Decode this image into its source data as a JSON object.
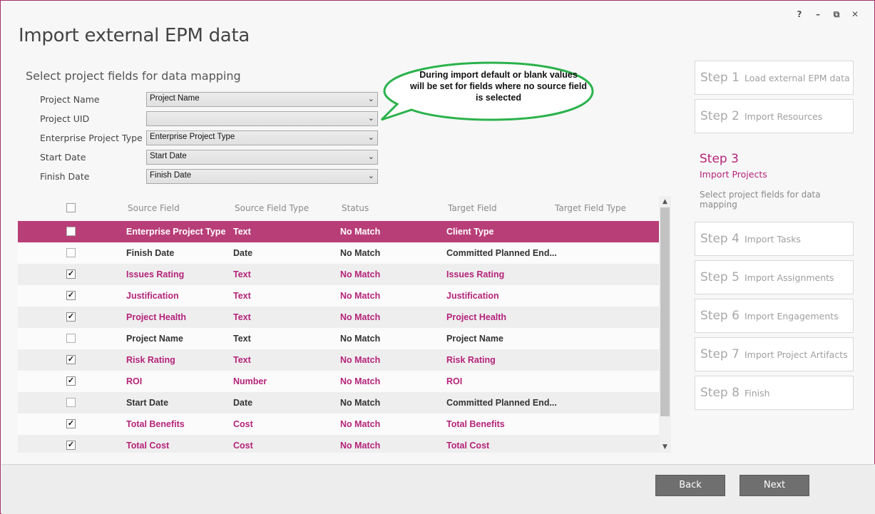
{
  "window": {
    "title": "Import external EPM data",
    "controls": {
      "help": "?",
      "minimize": "–",
      "restore": "⧉",
      "close": "✕"
    }
  },
  "mapping": {
    "heading": "Select project fields for data mapping",
    "fields": [
      {
        "label": "Project Name",
        "value": "Project Name"
      },
      {
        "label": "Project UID",
        "value": ""
      },
      {
        "label": "Enterprise Project Type",
        "value": "Enterprise Project Type"
      },
      {
        "label": "Start Date",
        "value": "Start Date"
      },
      {
        "label": "Finish Date",
        "value": "Finish Date"
      }
    ]
  },
  "callout": {
    "text": "During import default or blank values will be set for fields where no source field is selected",
    "line1": "During import default or blank values",
    "line2": "will be set for fields where no source field",
    "line3": "is selected",
    "border_color": "#2bb24c"
  },
  "table": {
    "columns": [
      "Source Field",
      "Source Field Type",
      "Status",
      "Target Field",
      "Target Field Type"
    ],
    "rows": [
      {
        "checked": false,
        "source": "Enterprise Project Type",
        "type": "Text",
        "status": "No Match",
        "target": "Client Type",
        "target_type": "",
        "selected": true
      },
      {
        "checked": false,
        "source": "Finish Date",
        "type": "Date",
        "status": "No Match",
        "target": "Committed Planned End...",
        "target_type": ""
      },
      {
        "checked": true,
        "source": "Issues Rating",
        "type": "Text",
        "status": "No Match",
        "target": "Issues Rating",
        "target_type": ""
      },
      {
        "checked": true,
        "source": "Justification",
        "type": "Text",
        "status": "No Match",
        "target": "Justification",
        "target_type": ""
      },
      {
        "checked": true,
        "source": "Project Health",
        "type": "Text",
        "status": "No Match",
        "target": "Project Health",
        "target_type": ""
      },
      {
        "checked": false,
        "source": "Project Name",
        "type": "Text",
        "status": "No Match",
        "target": "Project Name",
        "target_type": ""
      },
      {
        "checked": true,
        "source": "Risk Rating",
        "type": "Text",
        "status": "No Match",
        "target": "Risk Rating",
        "target_type": ""
      },
      {
        "checked": true,
        "source": "ROI",
        "type": "Number",
        "status": "No Match",
        "target": "ROI",
        "target_type": ""
      },
      {
        "checked": false,
        "source": "Start Date",
        "type": "Date",
        "status": "No Match",
        "target": "Committed Planned End...",
        "target_type": ""
      },
      {
        "checked": true,
        "source": "Total Benefits",
        "type": "Cost",
        "status": "No Match",
        "target": "Total Benefits",
        "target_type": ""
      },
      {
        "checked": true,
        "source": "Total Cost",
        "type": "Cost",
        "status": "No Match",
        "target": "Total Cost",
        "target_type": ""
      }
    ]
  },
  "steps": [
    {
      "num": "Step 1",
      "label": "Load external EPM data"
    },
    {
      "num": "Step 2",
      "label": "Import Resources"
    },
    {
      "num": "Step 3",
      "label": "Import Projects",
      "desc": "Select project fields for data mapping",
      "active": true
    },
    {
      "num": "Step 4",
      "label": "Import Tasks"
    },
    {
      "num": "Step 5",
      "label": "Import Assignments"
    },
    {
      "num": "Step 6",
      "label": "Import Engagements"
    },
    {
      "num": "Step 7",
      "label": "Import Project Artifacts"
    },
    {
      "num": "Step 8",
      "label": "Finish"
    }
  ],
  "footer": {
    "back": "Back",
    "next": "Next"
  },
  "colors": {
    "accent": "#b5237a",
    "selected_row": "#b83e78",
    "window_border": "#a4306a",
    "button": "#6f6f6f"
  },
  "icons": {
    "dropdown": "chevron-down-icon",
    "check": "checkmark-icon"
  }
}
